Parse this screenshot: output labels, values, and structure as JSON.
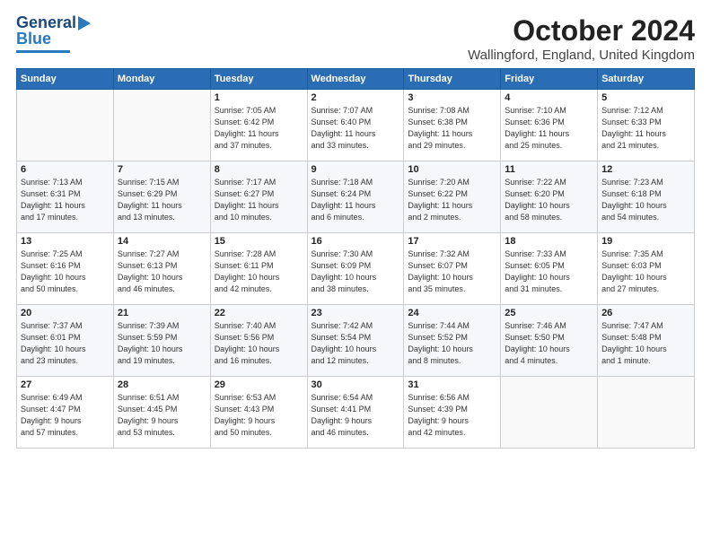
{
  "logo": {
    "line1": "General",
    "line2": "Blue"
  },
  "header": {
    "month": "October 2024",
    "location": "Wallingford, England, United Kingdom"
  },
  "days_of_week": [
    "Sunday",
    "Monday",
    "Tuesday",
    "Wednesday",
    "Thursday",
    "Friday",
    "Saturday"
  ],
  "weeks": [
    [
      {
        "day": "",
        "info": ""
      },
      {
        "day": "",
        "info": ""
      },
      {
        "day": "1",
        "info": "Sunrise: 7:05 AM\nSunset: 6:42 PM\nDaylight: 11 hours\nand 37 minutes."
      },
      {
        "day": "2",
        "info": "Sunrise: 7:07 AM\nSunset: 6:40 PM\nDaylight: 11 hours\nand 33 minutes."
      },
      {
        "day": "3",
        "info": "Sunrise: 7:08 AM\nSunset: 6:38 PM\nDaylight: 11 hours\nand 29 minutes."
      },
      {
        "day": "4",
        "info": "Sunrise: 7:10 AM\nSunset: 6:36 PM\nDaylight: 11 hours\nand 25 minutes."
      },
      {
        "day": "5",
        "info": "Sunrise: 7:12 AM\nSunset: 6:33 PM\nDaylight: 11 hours\nand 21 minutes."
      }
    ],
    [
      {
        "day": "6",
        "info": "Sunrise: 7:13 AM\nSunset: 6:31 PM\nDaylight: 11 hours\nand 17 minutes."
      },
      {
        "day": "7",
        "info": "Sunrise: 7:15 AM\nSunset: 6:29 PM\nDaylight: 11 hours\nand 13 minutes."
      },
      {
        "day": "8",
        "info": "Sunrise: 7:17 AM\nSunset: 6:27 PM\nDaylight: 11 hours\nand 10 minutes."
      },
      {
        "day": "9",
        "info": "Sunrise: 7:18 AM\nSunset: 6:24 PM\nDaylight: 11 hours\nand 6 minutes."
      },
      {
        "day": "10",
        "info": "Sunrise: 7:20 AM\nSunset: 6:22 PM\nDaylight: 11 hours\nand 2 minutes."
      },
      {
        "day": "11",
        "info": "Sunrise: 7:22 AM\nSunset: 6:20 PM\nDaylight: 10 hours\nand 58 minutes."
      },
      {
        "day": "12",
        "info": "Sunrise: 7:23 AM\nSunset: 6:18 PM\nDaylight: 10 hours\nand 54 minutes."
      }
    ],
    [
      {
        "day": "13",
        "info": "Sunrise: 7:25 AM\nSunset: 6:16 PM\nDaylight: 10 hours\nand 50 minutes."
      },
      {
        "day": "14",
        "info": "Sunrise: 7:27 AM\nSunset: 6:13 PM\nDaylight: 10 hours\nand 46 minutes."
      },
      {
        "day": "15",
        "info": "Sunrise: 7:28 AM\nSunset: 6:11 PM\nDaylight: 10 hours\nand 42 minutes."
      },
      {
        "day": "16",
        "info": "Sunrise: 7:30 AM\nSunset: 6:09 PM\nDaylight: 10 hours\nand 38 minutes."
      },
      {
        "day": "17",
        "info": "Sunrise: 7:32 AM\nSunset: 6:07 PM\nDaylight: 10 hours\nand 35 minutes."
      },
      {
        "day": "18",
        "info": "Sunrise: 7:33 AM\nSunset: 6:05 PM\nDaylight: 10 hours\nand 31 minutes."
      },
      {
        "day": "19",
        "info": "Sunrise: 7:35 AM\nSunset: 6:03 PM\nDaylight: 10 hours\nand 27 minutes."
      }
    ],
    [
      {
        "day": "20",
        "info": "Sunrise: 7:37 AM\nSunset: 6:01 PM\nDaylight: 10 hours\nand 23 minutes."
      },
      {
        "day": "21",
        "info": "Sunrise: 7:39 AM\nSunset: 5:59 PM\nDaylight: 10 hours\nand 19 minutes."
      },
      {
        "day": "22",
        "info": "Sunrise: 7:40 AM\nSunset: 5:56 PM\nDaylight: 10 hours\nand 16 minutes."
      },
      {
        "day": "23",
        "info": "Sunrise: 7:42 AM\nSunset: 5:54 PM\nDaylight: 10 hours\nand 12 minutes."
      },
      {
        "day": "24",
        "info": "Sunrise: 7:44 AM\nSunset: 5:52 PM\nDaylight: 10 hours\nand 8 minutes."
      },
      {
        "day": "25",
        "info": "Sunrise: 7:46 AM\nSunset: 5:50 PM\nDaylight: 10 hours\nand 4 minutes."
      },
      {
        "day": "26",
        "info": "Sunrise: 7:47 AM\nSunset: 5:48 PM\nDaylight: 10 hours\nand 1 minute."
      }
    ],
    [
      {
        "day": "27",
        "info": "Sunrise: 6:49 AM\nSunset: 4:47 PM\nDaylight: 9 hours\nand 57 minutes."
      },
      {
        "day": "28",
        "info": "Sunrise: 6:51 AM\nSunset: 4:45 PM\nDaylight: 9 hours\nand 53 minutes."
      },
      {
        "day": "29",
        "info": "Sunrise: 6:53 AM\nSunset: 4:43 PM\nDaylight: 9 hours\nand 50 minutes."
      },
      {
        "day": "30",
        "info": "Sunrise: 6:54 AM\nSunset: 4:41 PM\nDaylight: 9 hours\nand 46 minutes."
      },
      {
        "day": "31",
        "info": "Sunrise: 6:56 AM\nSunset: 4:39 PM\nDaylight: 9 hours\nand 42 minutes."
      },
      {
        "day": "",
        "info": ""
      },
      {
        "day": "",
        "info": ""
      }
    ]
  ]
}
